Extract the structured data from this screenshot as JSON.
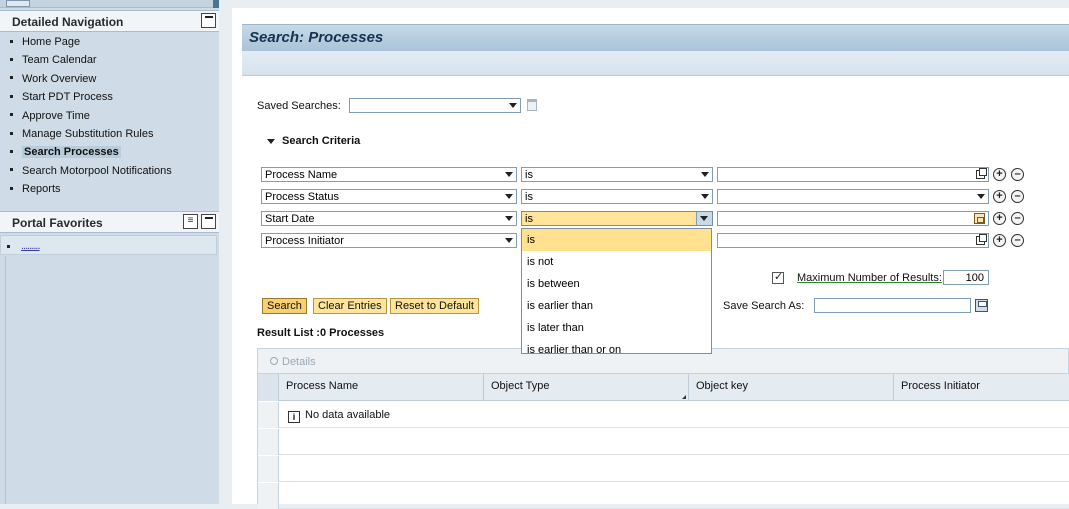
{
  "left_nav": {
    "detailed_navigation": {
      "title": "Detailed Navigation",
      "items": [
        {
          "label": "Home Page",
          "active": false
        },
        {
          "label": "Team Calendar",
          "active": false
        },
        {
          "label": "Work Overview",
          "active": false
        },
        {
          "label": "Start PDT Process",
          "active": false
        },
        {
          "label": "Approve Time",
          "active": false
        },
        {
          "label": "Manage Substitution Rules",
          "active": false
        },
        {
          "label": "Search Processes",
          "active": true
        },
        {
          "label": "Search Motorpool Notifications",
          "active": false
        },
        {
          "label": "Reports",
          "active": false
        }
      ]
    },
    "portal_favorites": {
      "title": "Portal Favorites",
      "item_label": "........."
    }
  },
  "page": {
    "title": "Search: Processes"
  },
  "saved_searches": {
    "label": "Saved Searches:",
    "value": ""
  },
  "search_criteria": {
    "title": "Search Criteria",
    "rows": [
      {
        "field": "Process Name",
        "operator": "is",
        "value": "",
        "value_icon": "copy-icon"
      },
      {
        "field": "Process Status",
        "operator": "is",
        "value": "",
        "value_icon": "dropdown"
      },
      {
        "field": "Start Date",
        "operator": "is",
        "value": "",
        "value_icon": "calendar-icon"
      },
      {
        "field": "Process Initiator",
        "operator": "",
        "value": "",
        "value_icon": "copy-icon"
      }
    ],
    "operator_options": [
      "is",
      "is not",
      "is between",
      "is earlier than",
      "is later than",
      "is earlier than or on"
    ],
    "selected_operator": "is"
  },
  "max_results": {
    "checked": true,
    "label": "Maximum Number of Results:",
    "value": "100"
  },
  "buttons": {
    "search": "Search",
    "clear": "Clear Entries",
    "reset": "Reset to Default"
  },
  "save_search": {
    "label": "Save Search As:",
    "value": ""
  },
  "results": {
    "title": "Result List :0 Processes",
    "toolbar_details": "Details",
    "columns": [
      "Process Name",
      "Object Type",
      "Object key",
      "Process Initiator"
    ],
    "empty_message": "No data available"
  },
  "colors": {
    "nav_bg": "#cfdbe6",
    "title_bar": "#b7cde0",
    "button_bg": "#ffe49a",
    "highlight": "#ffe18f"
  }
}
